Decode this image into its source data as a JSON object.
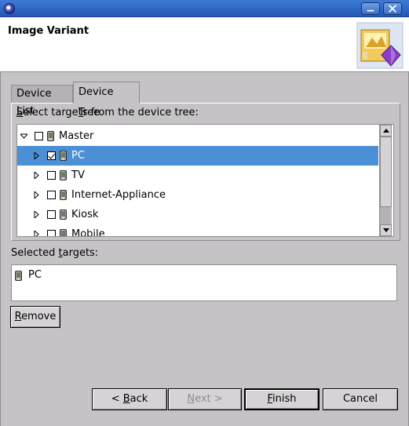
{
  "window": {
    "title": ""
  },
  "header": {
    "title": "Image Variant",
    "icon": "wizard-banner-icon"
  },
  "tabs": [
    {
      "label_pre": "Device ",
      "label_mnemonic": "L",
      "label_post": "ist",
      "active": false
    },
    {
      "label_pre": "Device ",
      "label_mnemonic": "T",
      "label_post": "ree",
      "active": true
    }
  ],
  "tree_section": {
    "label_mnemonic": "S",
    "label_post": "elect targets from the device tree:"
  },
  "tree": {
    "rows": [
      {
        "label": "Master",
        "level": 0,
        "expander": "expanded",
        "checked": false,
        "selected": false
      },
      {
        "label": "PC",
        "level": 1,
        "expander": "collapsed",
        "checked": true,
        "selected": true
      },
      {
        "label": "TV",
        "level": 1,
        "expander": "collapsed",
        "checked": false,
        "selected": false
      },
      {
        "label": "Internet-Appliance",
        "level": 1,
        "expander": "collapsed",
        "checked": false,
        "selected": false
      },
      {
        "label": "Kiosk",
        "level": 1,
        "expander": "collapsed",
        "checked": false,
        "selected": false
      },
      {
        "label": "Mobile",
        "level": 1,
        "expander": "collapsed",
        "checked": false,
        "selected": false
      }
    ]
  },
  "selected_section": {
    "label_pre": "Selected ",
    "label_mnemonic": "t",
    "label_post": "argets:",
    "items": [
      {
        "label": "PC"
      }
    ]
  },
  "buttons": {
    "remove": {
      "mnemonic": "R",
      "post": "emove"
    },
    "back": {
      "pre": "< ",
      "mnemonic": "B",
      "post": "ack"
    },
    "next": {
      "mnemonic": "N",
      "post": "ext >"
    },
    "finish": {
      "mnemonic": "F",
      "post": "inish"
    },
    "cancel": {
      "label": "Cancel"
    }
  },
  "colors": {
    "titlebar": "#2f66c4",
    "selection": "#4b8fd5",
    "dialog_bg": "#c6c3c6"
  }
}
